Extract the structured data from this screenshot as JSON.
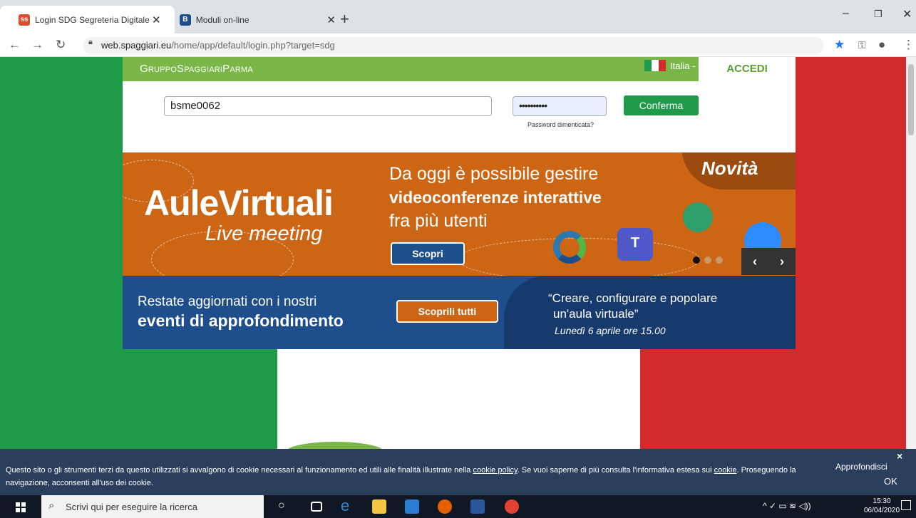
{
  "browser": {
    "tabs": [
      {
        "title": "Login SDG Segreteria Digitale Gr",
        "favicon": "ss",
        "favicon_color": "#e0492b"
      },
      {
        "title": "Moduli on-line",
        "favicon": "B",
        "favicon_color": "#1f4e8c"
      }
    ],
    "new_tab": "+",
    "url_host": "web.spaggiari.eu",
    "url_path": "/home/app/default/login.php?target=sdg",
    "window_controls": {
      "minimize": "–",
      "maximize": "❐",
      "close": "✕"
    }
  },
  "header": {
    "brand": "GruppoSpaggiariParma",
    "language": "Italia - it",
    "login_tab": "ACCEDI"
  },
  "login": {
    "username_value": "bsme0062",
    "password_value": "••••••••••",
    "confirm_label": "Conferma",
    "forgot_label": "Password dimenticata?"
  },
  "banner_aule": {
    "title": "AuleVirtuali",
    "subtitle": "Live meeting",
    "line1": "Da oggi è possibile gestire",
    "line2": "videoconferenze interattive",
    "line3": "fra più utenti",
    "cta": "Scopri",
    "badge": "Novità",
    "prev": "‹",
    "next": "›"
  },
  "banner_eventi": {
    "line1": "Restate aggiornati con i nostri",
    "line2": "eventi di approfondimento",
    "cta": "Scoprili tutti",
    "event_title1": "“Creare, configurare e popolare",
    "event_title2": "un'aula virtuale”",
    "event_date": "Lunedì 6 aprile ore 15.00"
  },
  "cookie": {
    "text_part1": "Questo sito o gli strumenti terzi da questo utilizzati si avvalgono di cookie necessari al funzionamento ed utili alle finalità illustrate nella ",
    "link1": "cookie policy",
    "text_part2": ". Se vuoi saperne di più consulta l'informativa estesa sui ",
    "link2": "cookie",
    "text_part3": ". Proseguendo la navigazione, acconsenti all'uso dei cookie.",
    "more": "Approfondisci",
    "ok": "OK",
    "close": "×"
  },
  "taskbar": {
    "search_placeholder": "Scrivi qui per eseguire la ricerca",
    "time": "15:30",
    "date": "06/04/2020"
  },
  "colors": {
    "flag_green": "#1e9a48",
    "flag_red": "#d32a2c",
    "header_green": "#7ab648",
    "banner_orange": "#cc6614",
    "banner_blue": "#1f4e8c",
    "cookie_bar": "#2b3f5c"
  }
}
